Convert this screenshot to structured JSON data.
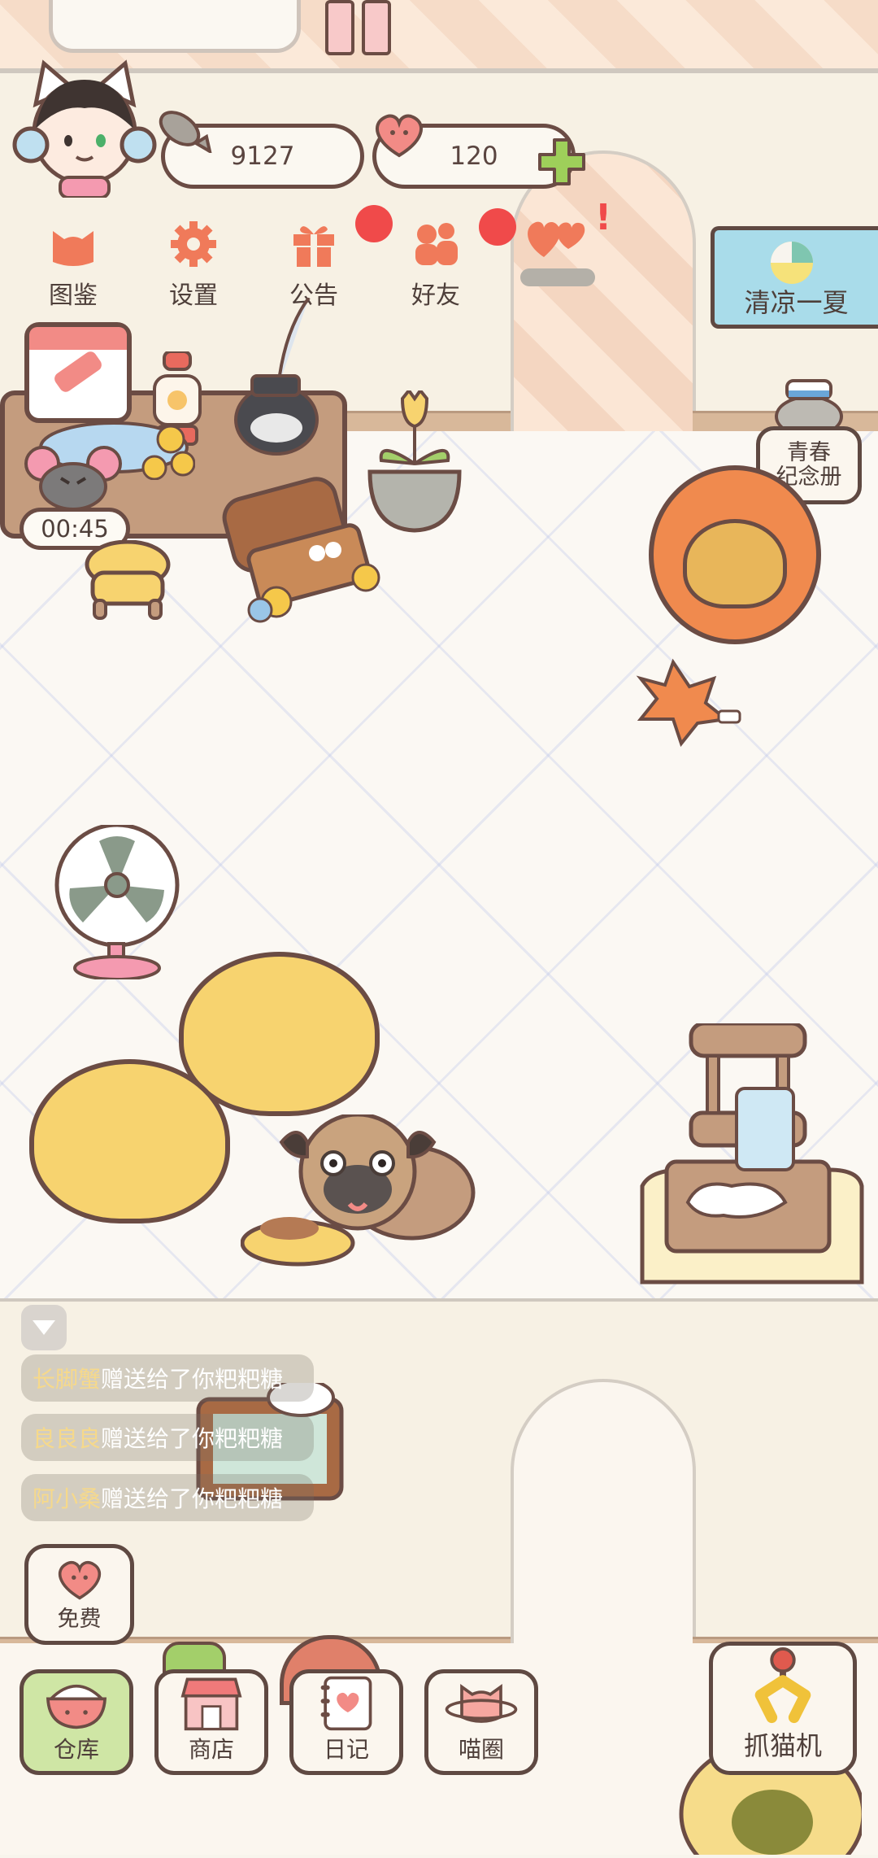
{
  "hud": {
    "fish_count": "9127",
    "heart_count": "120"
  },
  "menu": [
    {
      "label": "图鉴",
      "icon": "cat-head-icon",
      "badge": false
    },
    {
      "label": "设置",
      "icon": "gear-icon",
      "badge": false
    },
    {
      "label": "公告",
      "icon": "gift-icon",
      "badge": true
    },
    {
      "label": "好友",
      "icon": "friends-icon",
      "badge": true
    },
    {
      "label": "",
      "icon": "hearts-icon",
      "badge": false,
      "exclaim": "!"
    }
  ],
  "events": {
    "summer_banner": "清凉一夏",
    "youth_album_line1": "青春",
    "youth_album_line2": "纪念册"
  },
  "timer": "00:45",
  "chat": [
    {
      "name": "长脚蟹",
      "text": "赠送给了你粑粑糖"
    },
    {
      "name": "良良良",
      "text": "赠送给了你粑粑糖"
    },
    {
      "name": "阿小桑",
      "text": "赠送给了你粑粑糖"
    }
  ],
  "free_button": "免费",
  "bottom_nav": [
    {
      "label": "仓库",
      "icon": "rice-bowl-icon",
      "active": true
    },
    {
      "label": "商店",
      "icon": "shop-icon",
      "active": false
    },
    {
      "label": "日记",
      "icon": "diary-icon",
      "active": false
    },
    {
      "label": "喵圈",
      "icon": "cat-planet-icon",
      "active": false
    }
  ],
  "claw_machine": "抓猫机",
  "colors": {
    "outline": "#6b4c44",
    "accent_red": "#f04a4a",
    "coral": "#f07a5a",
    "mint": "#cfe6a5",
    "beanbag": "#f7d36f"
  }
}
